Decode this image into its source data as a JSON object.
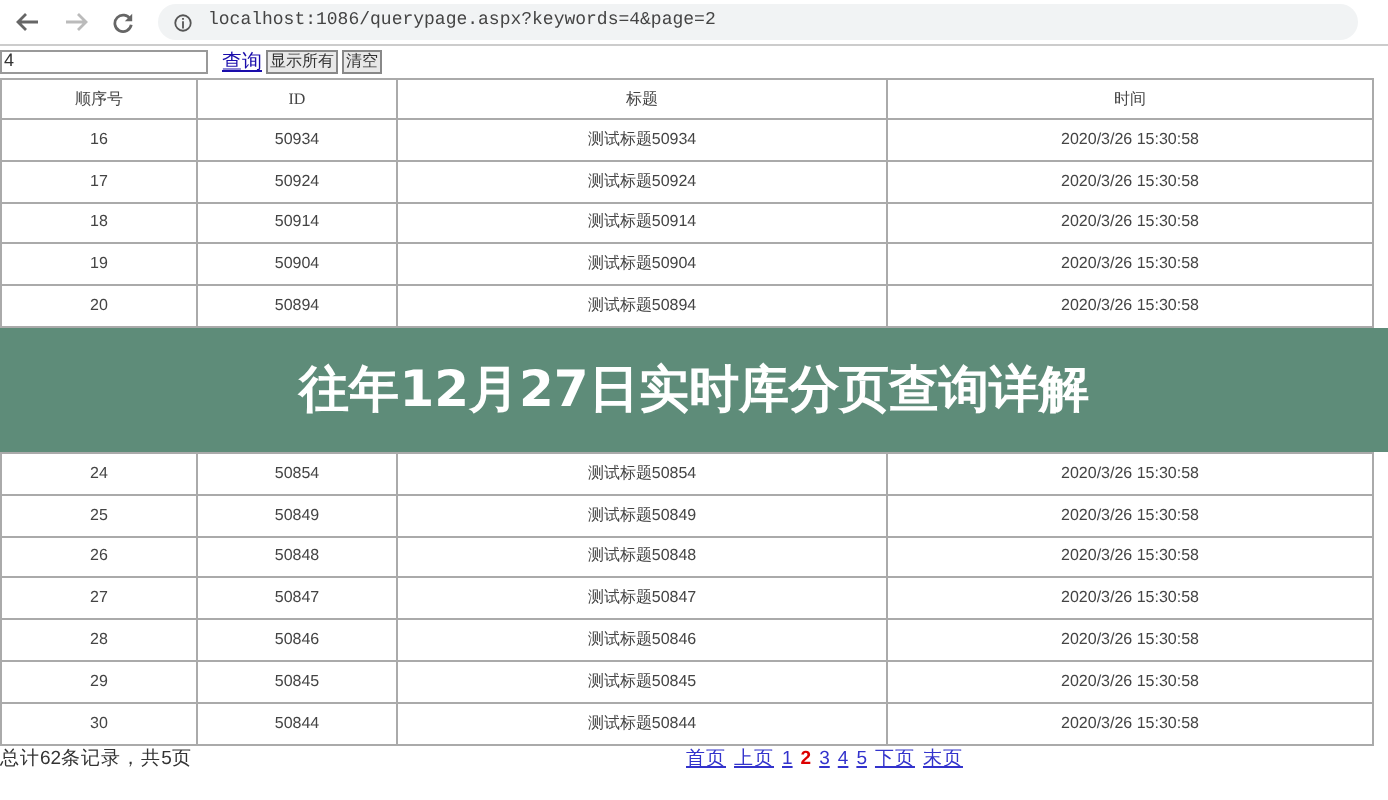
{
  "browser": {
    "url": "localhost:1086/querypage.aspx?keywords=4&page=2"
  },
  "search": {
    "value": "4",
    "buttons": [
      {
        "label": "查询",
        "kind": "link"
      },
      {
        "label": "显示所有",
        "kind": "button"
      },
      {
        "label": "清空",
        "kind": "button"
      }
    ]
  },
  "table": {
    "columns": [
      "顺序号",
      "ID",
      "标题",
      "时间"
    ],
    "rows": [
      [
        "16",
        "50934",
        "测试标题50934",
        "2020/3/26 15:30:58"
      ],
      [
        "17",
        "50924",
        "测试标题50924",
        "2020/3/26 15:30:58"
      ],
      [
        "18",
        "50914",
        "测试标题50914",
        "2020/3/26 15:30:58"
      ],
      [
        "19",
        "50904",
        "测试标题50904",
        "2020/3/26 15:30:58"
      ],
      [
        "20",
        "50894",
        "测试标题50894",
        "2020/3/26 15:30:58"
      ],
      [
        "24",
        "50854",
        "测试标题50854",
        "2020/3/26 15:30:58"
      ],
      [
        "25",
        "50849",
        "测试标题50849",
        "2020/3/26 15:30:58"
      ],
      [
        "26",
        "50848",
        "测试标题50848",
        "2020/3/26 15:30:58"
      ],
      [
        "27",
        "50847",
        "测试标题50847",
        "2020/3/26 15:30:58"
      ],
      [
        "28",
        "50846",
        "测试标题50846",
        "2020/3/26 15:30:58"
      ],
      [
        "29",
        "50845",
        "测试标题50845",
        "2020/3/26 15:30:58"
      ],
      [
        "30",
        "50844",
        "测试标题50844",
        "2020/3/26 15:30:58"
      ]
    ]
  },
  "summary": "总计62条记录，共5页",
  "pager": [
    {
      "label": "首页",
      "selected": false
    },
    {
      "label": "上页",
      "selected": false
    },
    {
      "label": "1",
      "selected": false
    },
    {
      "label": "2",
      "selected": true
    },
    {
      "label": "3",
      "selected": false
    },
    {
      "label": "4",
      "selected": false
    },
    {
      "label": "5",
      "selected": false
    },
    {
      "label": "下页",
      "selected": false
    },
    {
      "label": "末页",
      "selected": false
    }
  ],
  "banner": {
    "title": "往年12月27日实时库分页查询详解"
  }
}
